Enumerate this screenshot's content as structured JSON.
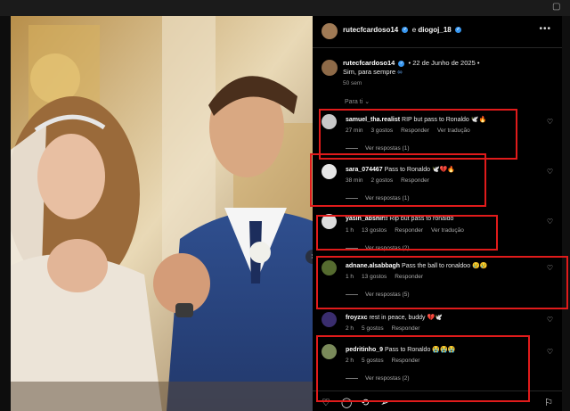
{
  "header": {
    "user1": "rutecfcardoso14",
    "connector": "e",
    "user2": "diogoj_18",
    "more_icon": "more-horizontal-icon"
  },
  "caption": {
    "user": "rutecfcardoso14",
    "date": "• 22 de Junho de 2025 •",
    "text": "Sim, para sempre",
    "emoji": "∞",
    "ago": "50 sem"
  },
  "sort_label": "Para ti",
  "comments": [
    {
      "user": "samuel_tha.realist",
      "text": "RIP but pass to Ronaldo",
      "emoji": "🕊️🔥",
      "time": "27 min",
      "likes": "3 gostos",
      "reply": "Responder",
      "translate": "Ver tradução",
      "replies": "Ver respostas (1)",
      "avatar_color": "#c9c9c9"
    },
    {
      "user": "sara_074467",
      "text": "Pass to Ronaldo",
      "emoji": "🕊️💔🔥",
      "time": "38 min",
      "likes": "2 gostos",
      "reply": "Responder",
      "translate": "",
      "replies": "Ver respostas (1)",
      "avatar_color": "#e6e6e6"
    },
    {
      "user": "yasin_abshir!!",
      "text": "Rip but pass to ronaldo",
      "emoji": "",
      "time": "1 h",
      "likes": "13 gostos",
      "reply": "Responder",
      "translate": "Ver tradução",
      "replies": "Ver respostas (2)",
      "avatar_color": "#dcdcdc"
    },
    {
      "user": "adnane.alsabbagh",
      "text": "Pass the ball to ronaldoo",
      "emoji": "😢😢",
      "time": "1 h",
      "likes": "13 gostos",
      "reply": "Responder",
      "translate": "",
      "replies": "Ver respostas (5)",
      "avatar_color": "#556b2f"
    },
    {
      "user": "froyzxc",
      "text": "rest in peace, buddy",
      "emoji": "💔🕊️",
      "time": "2 h",
      "likes": "5 gostos",
      "reply": "Responder",
      "translate": "",
      "replies": "",
      "avatar_color": "#3a2d6e"
    },
    {
      "user": "pedritinho_9",
      "text": "Pass to Ronaldo",
      "emoji": "😭😭😭",
      "time": "2 h",
      "likes": "5 gostos",
      "reply": "Responder",
      "translate": "",
      "replies": "Ver respostas (2)",
      "avatar_color": "#7a8a5a"
    }
  ],
  "actions": {
    "like_icon": "heart-icon",
    "comment_icon": "comment-icon",
    "repost_icon": "repost-icon",
    "share_icon": "send-icon",
    "save_icon": "bookmark-icon"
  },
  "colors": {
    "highlight": "#e01b1b",
    "verified": "#3897f0",
    "panel_bg": "#000000"
  }
}
